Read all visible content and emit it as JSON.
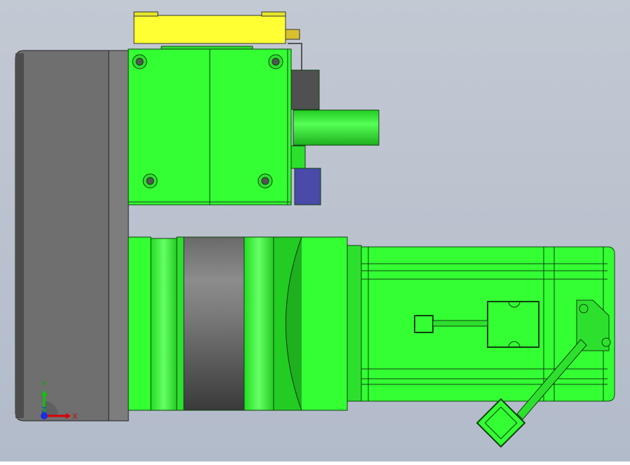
{
  "viewport": {
    "background_top": "#c3c9d3",
    "background_bottom": "#b0b9c8"
  },
  "colors": {
    "part_green": "#33ff33",
    "part_green_dark": "#1fcc1f",
    "flange_gray": "#6f6f6f",
    "sensor_yellow": "#ffff33",
    "block_blue": "#4a4aa8",
    "edge": "#103010"
  },
  "triad": {
    "x_label": "X",
    "y_label": "Y",
    "z_label": "Z"
  }
}
